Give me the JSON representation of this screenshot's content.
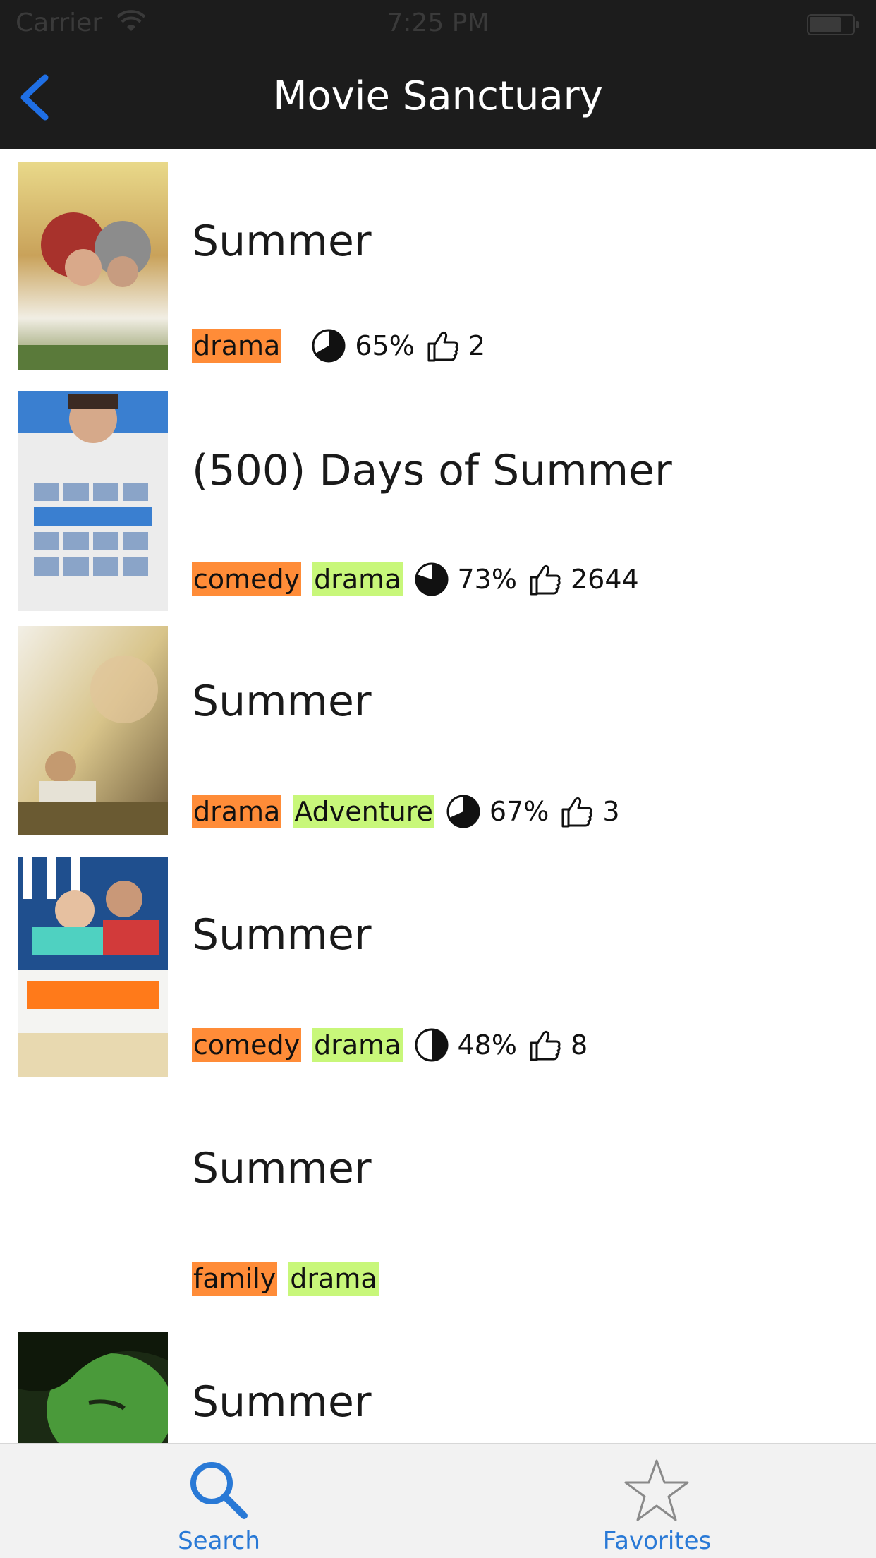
{
  "status_bar": {
    "carrier": "Carrier",
    "time": "7:25 PM"
  },
  "nav": {
    "title": "Movie Sanctuary",
    "back_icon": "chevron-left-icon"
  },
  "accent_colors": {
    "tag_primary": "#ff8c38",
    "tag_secondary": "#c8f77a",
    "tint": "#2979d6",
    "nav_background": "#1c1c1c"
  },
  "movies": [
    {
      "title": "Summer",
      "genres": [
        "drama"
      ],
      "rating": "65%",
      "likes": "2",
      "poster": "summer-poster-1"
    },
    {
      "title": "(500) Days of Summer",
      "genres": [
        "comedy",
        "drama"
      ],
      "rating": "73%",
      "likes": "2644",
      "poster": "500-days-of-summer-poster"
    },
    {
      "title": "Summer",
      "genres": [
        "drama",
        "Adventure"
      ],
      "rating": "67%",
      "likes": "3",
      "poster": "summer-poster-3"
    },
    {
      "title": "Summer",
      "genres": [
        "comedy",
        "drama"
      ],
      "rating": "48%",
      "likes": "8",
      "poster": "sommer-poster"
    },
    {
      "title": "Summer",
      "genres": [
        "family",
        "drama"
      ],
      "rating": "",
      "likes": "",
      "poster": ""
    },
    {
      "title": "Summer",
      "genres": [],
      "rating": "",
      "likes": "",
      "poster": "summer-poster-green"
    }
  ],
  "tabs": [
    {
      "label": "Search",
      "icon": "search-icon",
      "selected": true
    },
    {
      "label": "Favorites",
      "icon": "star-icon",
      "selected": false
    }
  ]
}
